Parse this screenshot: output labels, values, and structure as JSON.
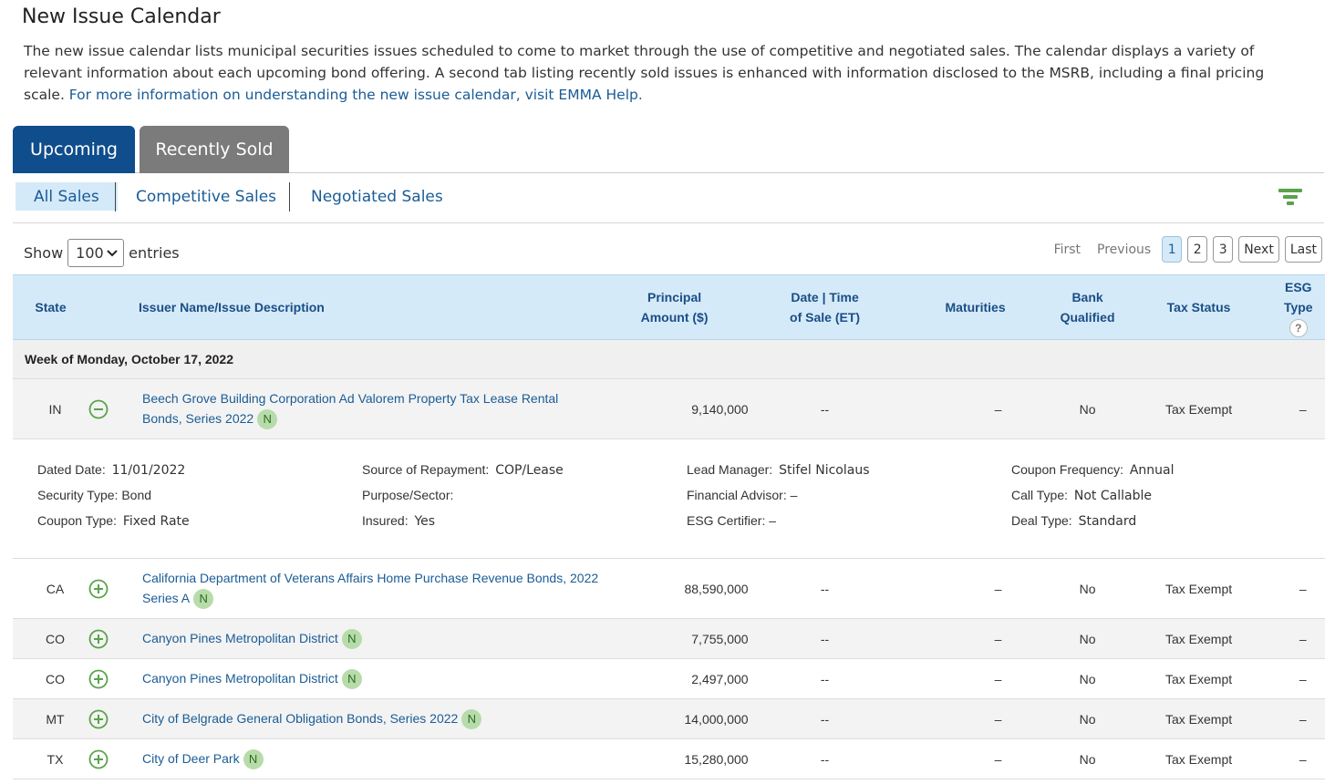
{
  "page": {
    "title": "New Issue Calendar",
    "intro": "The new issue calendar lists municipal securities issues scheduled to come to market through the use of competitive and negotiated sales. The calendar displays a variety of relevant information about each upcoming bond offering. A second tab listing recently sold issues is enhanced with information disclosed to the MSRB, including a final pricing scale. ",
    "intro_link": "For more information on understanding the new issue calendar, visit EMMA Help."
  },
  "tabs": {
    "upcoming": "Upcoming",
    "recently_sold": "Recently Sold"
  },
  "subtabs": {
    "all": "All Sales",
    "competitive": "Competitive Sales",
    "negotiated": "Negotiated Sales"
  },
  "entries": {
    "show": "Show",
    "value": "100",
    "suffix": "entries"
  },
  "pager": {
    "first": "First",
    "previous": "Previous",
    "pages": [
      "1",
      "2",
      "3"
    ],
    "next": "Next",
    "last": "Last",
    "active_page": "1"
  },
  "table": {
    "headers": {
      "state": "State",
      "issuer": "Issuer Name/Issue Description",
      "principal_1": "Principal",
      "principal_2": "Amount ($)",
      "date_1": "Date | Time",
      "date_2": "of Sale (ET)",
      "maturities": "Maturities",
      "bank_1": "Bank",
      "bank_2": "Qualified",
      "tax": "Tax Status",
      "esg": "ESG Type"
    },
    "week_label": "Week of Monday, October 17, 2022",
    "rows": [
      {
        "state": "IN",
        "issuer": "Beech Grove Building Corporation Ad Valorem Property Tax Lease Rental Bonds, Series 2022",
        "badge": "N",
        "amount": "9,140,000",
        "date": "--",
        "maturities": "–",
        "bank": "No",
        "tax": "Tax Exempt",
        "esg": "–"
      },
      {
        "state": "CA",
        "issuer": "California Department of Veterans Affairs Home Purchase Revenue Bonds, 2022 Series A",
        "badge": "N",
        "amount": "88,590,000",
        "date": "--",
        "maturities": "–",
        "bank": "No",
        "tax": "Tax Exempt",
        "esg": "–"
      },
      {
        "state": "CO",
        "issuer": "Canyon Pines Metropolitan District",
        "badge": "N",
        "amount": "7,755,000",
        "date": "--",
        "maturities": "–",
        "bank": "No",
        "tax": "Tax Exempt",
        "esg": "–"
      },
      {
        "state": "CO",
        "issuer": "Canyon Pines Metropolitan District",
        "badge": "N",
        "amount": "2,497,000",
        "date": "--",
        "maturities": "–",
        "bank": "No",
        "tax": "Tax Exempt",
        "esg": "–"
      },
      {
        "state": "MT",
        "issuer": "City of Belgrade General Obligation Bonds, Series 2022",
        "badge": "N",
        "amount": "14,000,000",
        "date": "--",
        "maturities": "–",
        "bank": "No",
        "tax": "Tax Exempt",
        "esg": "–"
      },
      {
        "state": "TX",
        "issuer": "City of Deer Park",
        "badge": "N",
        "amount": "15,280,000",
        "date": "--",
        "maturities": "–",
        "bank": "No",
        "tax": "Tax Exempt",
        "esg": "–"
      }
    ],
    "detail": {
      "dated_date_label": "Dated Date:",
      "dated_date": "11/01/2022",
      "security_type_label": "Security Type:",
      "security_type": "Bond",
      "coupon_type_label": "Coupon Type:",
      "coupon_type": "Fixed Rate",
      "source_label": "Source of Repayment:",
      "source": "COP/Lease",
      "purpose_label": "Purpose/Sector:",
      "purpose": "",
      "insured_label": "Insured:",
      "insured": "Yes",
      "lead_label": "Lead Manager:",
      "lead": "Stifel Nicolaus",
      "advisor_label": "Financial Advisor:",
      "advisor": "–",
      "certifier_label": "ESG Certifier:",
      "certifier": "–",
      "freq_label": "Coupon Frequency:",
      "freq": "Annual",
      "call_label": "Call Type:",
      "call": "Not Callable",
      "deal_label": "Deal Type:",
      "deal": "Standard"
    }
  },
  "colors": {
    "accent": "#0f4d8c",
    "header_bg": "#d5eaf8",
    "link": "#1a5c96",
    "toggle": "#5aa34a",
    "badge": "#b7dcaa"
  }
}
